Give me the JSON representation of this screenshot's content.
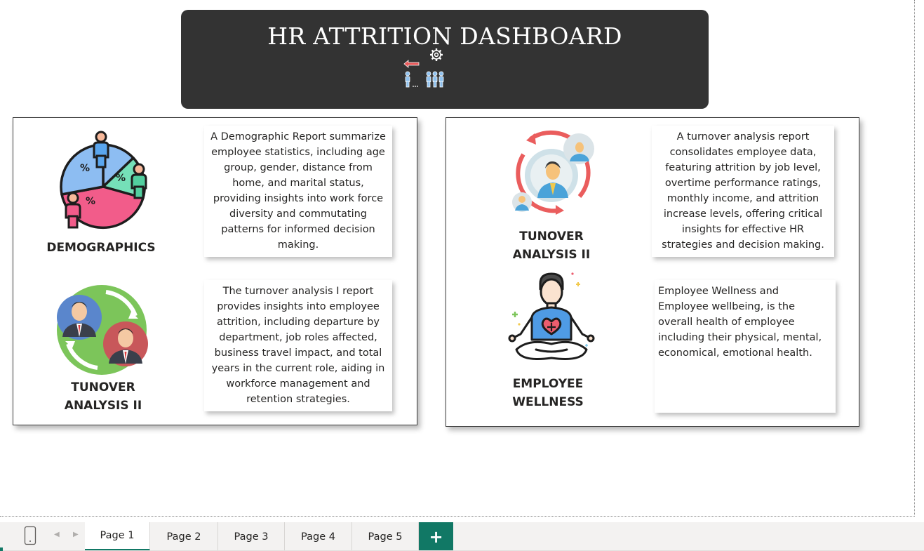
{
  "dashboard": {
    "title": "HR ATTRITION DASHBOARD",
    "logo_icon": "attrition-people-gear-icon"
  },
  "left_card": {
    "demographics": {
      "label": "DEMOGRAPHICS",
      "icon": "demographics-pie-people-icon",
      "description": "A Demographic Report summarize employee statistics, including age group, gender, distance from home, and marital status, providing insights into work force diversity and commutating patterns for informed decision making."
    },
    "turnover_one": {
      "label_line1": "TUNOVER",
      "label_line2": "ANALYSIS II",
      "icon": "employee-exchange-icon",
      "description": "The turnover analysis I report provides insights into employee attrition, including departure by department, job roles affected, business travel impact, and total years in the current role, aiding in workforce management and retention strategies."
    }
  },
  "right_card": {
    "turnover_two": {
      "label_line1": "TUNOVER",
      "label_line2": "ANALYSIS II",
      "icon": "employee-rotation-icon",
      "description": "A turnover analysis report consolidates employee data, featuring attrition by job level, overtime performance ratings, monthly income, and attrition increase levels, offering critical insights for effective HR strategies and decision making."
    },
    "wellness": {
      "label_line1": "EMPLOYEE",
      "label_line2": "WELLNESS",
      "icon": "meditation-wellness-icon",
      "description": "Employee Wellness and Employee wellbeing, is the overall health of employee including their physical, mental, economical, emotional health."
    }
  },
  "tabs": [
    {
      "label": "Page 1",
      "active": true
    },
    {
      "label": "Page 2",
      "active": false
    },
    {
      "label": "Page 3",
      "active": false
    },
    {
      "label": "Page 4",
      "active": false
    },
    {
      "label": "Page 5",
      "active": false
    }
  ],
  "add_tab_label": "+",
  "more_options_label": "...",
  "colors": {
    "header_bg": "#333333",
    "accent_green": "#117865"
  }
}
